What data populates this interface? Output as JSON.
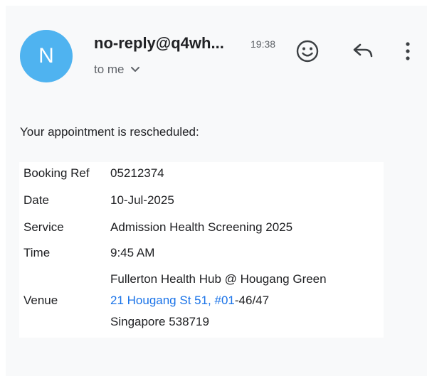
{
  "email": {
    "avatar_letter": "N",
    "sender": "no-reply@q4wh...",
    "time": "19:38",
    "recipient": "to me",
    "intro": "Your appointment is rescheduled:"
  },
  "details": {
    "booking_ref": {
      "label": "Booking Ref",
      "value": "05212374"
    },
    "date": {
      "label": "Date",
      "value": "10-Jul-2025"
    },
    "service": {
      "label": "Service",
      "value": "Admission Health Screening 2025"
    },
    "time": {
      "label": "Time",
      "value": "9:45 AM"
    },
    "venue": {
      "label": "Venue",
      "line1": "Fullerton Health Hub @ Hougang Green",
      "line2_link": "21 Hougang St 51, #01",
      "line2_rest": "-46/47",
      "line3": "Singapore 538719"
    }
  },
  "colors": {
    "avatar": "#4fb3f0",
    "link": "#1a73e8",
    "background": "#f8f9fa",
    "card": "#ffffff"
  },
  "icons": {
    "emoji": "smiley-face-icon",
    "reply": "reply-arrow-icon",
    "more": "more-vertical-icon",
    "expand": "chevron-down-icon"
  }
}
